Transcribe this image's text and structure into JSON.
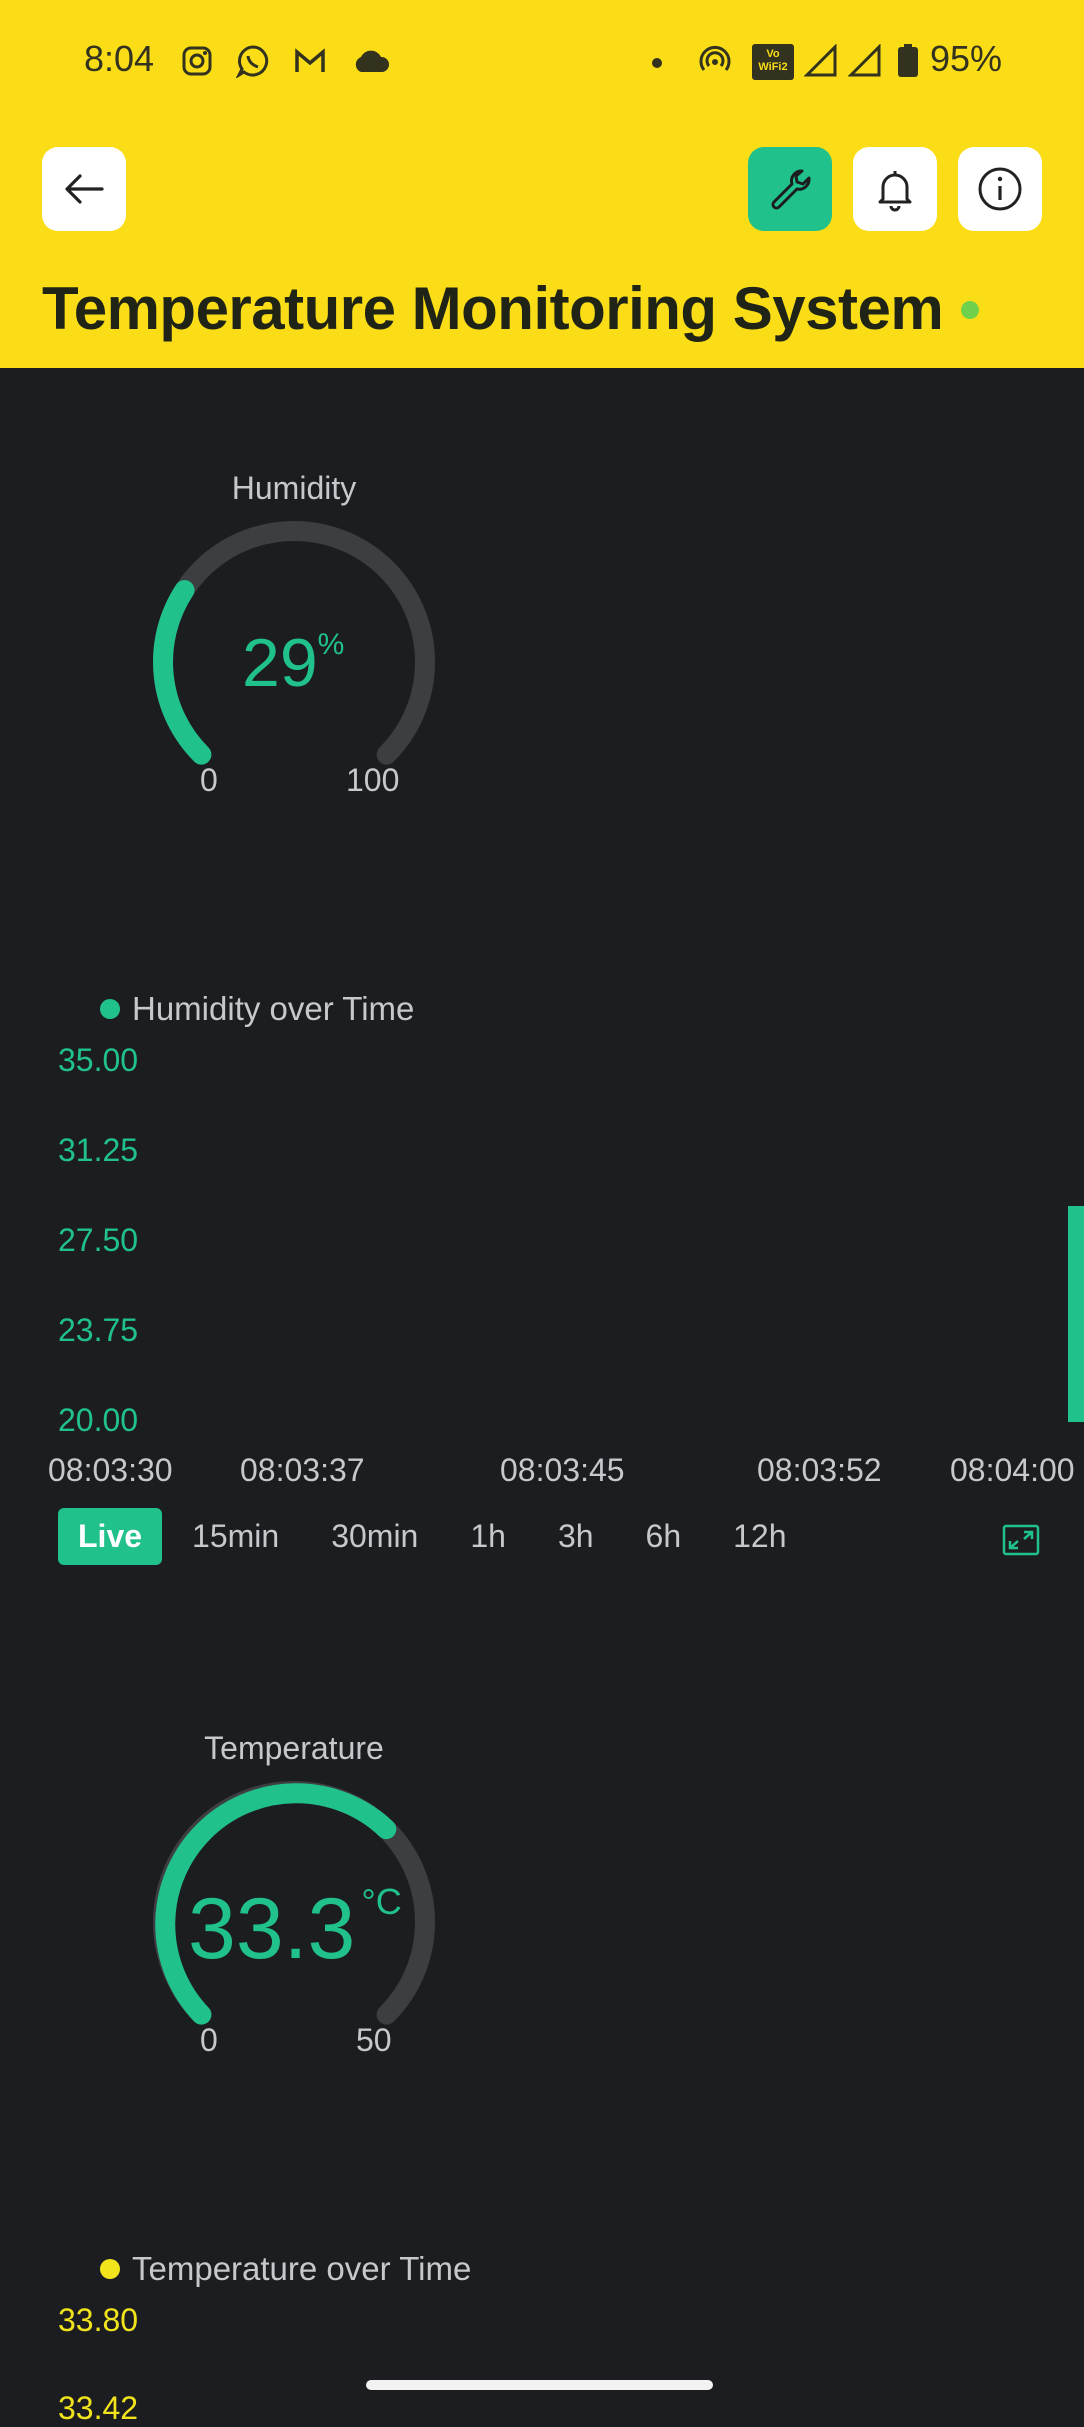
{
  "status_bar": {
    "time": "8:04",
    "left_icons": [
      "instagram-icon",
      "whatsapp-icon",
      "gmail-icon",
      "cloud-icon"
    ],
    "right_icons": [
      "dot-icon",
      "hotspot-icon",
      "vowifi-icon",
      "signal-icon",
      "signal-icon",
      "battery-icon"
    ],
    "vowifi_text": "Vo WiFi2",
    "battery": "95%"
  },
  "toolbar": {
    "back_icon": "arrow-left-icon",
    "buttons": [
      "wrench-icon",
      "bell-icon",
      "info-icon"
    ],
    "active_color": "#21c18b"
  },
  "page": {
    "title": "Temperature Monitoring System",
    "status_dot_color": "#6fd14b",
    "header_color": "#fadd17",
    "background": "#1c1d21",
    "accent": "#21c18b"
  },
  "humidity_gauge": {
    "title": "Humidity",
    "value": "29",
    "unit": "%",
    "min": "0",
    "max": "100",
    "fraction": 0.29
  },
  "humidity_chart": {
    "legend": "Humidity over Time",
    "legend_color": "#21c18b",
    "y_ticks": [
      "35.00",
      "31.25",
      "27.50",
      "23.75",
      "20.00"
    ],
    "x_ticks": [
      "08:03:30",
      "08:03:37",
      "08:03:45",
      "08:03:52",
      "08:04:00"
    ],
    "ranges": [
      "Live",
      "15min",
      "30min",
      "1h",
      "3h",
      "6h",
      "12h"
    ],
    "active_range": "Live",
    "expand_icon": "expand-icon"
  },
  "temperature_gauge": {
    "title": "Temperature",
    "value": "33.3",
    "unit": "°C",
    "min": "0",
    "max": "50",
    "fraction": 0.666
  },
  "temperature_chart": {
    "legend": "Temperature over Time",
    "legend_color": "#f2e41c",
    "y_ticks": [
      "33.80",
      "33.42"
    ]
  }
}
